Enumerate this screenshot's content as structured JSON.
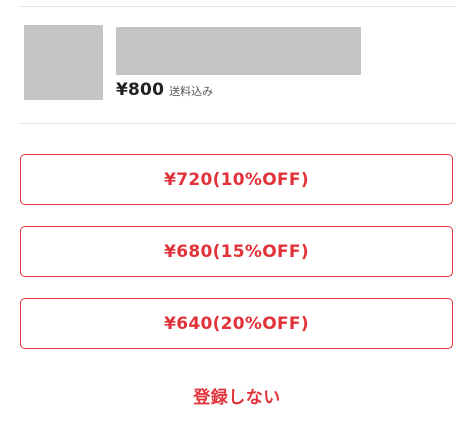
{
  "item": {
    "price": "¥800",
    "shipping_note": "送料込み"
  },
  "options": [
    {
      "label": "¥720(10%OFF)"
    },
    {
      "label": "¥680(15%OFF)"
    },
    {
      "label": "¥640(20%OFF)"
    }
  ],
  "skip_label": "登録しない",
  "colors": {
    "accent": "#e2333b",
    "placeholder": "#c4c4c4",
    "divider": "#e6e6e6"
  }
}
